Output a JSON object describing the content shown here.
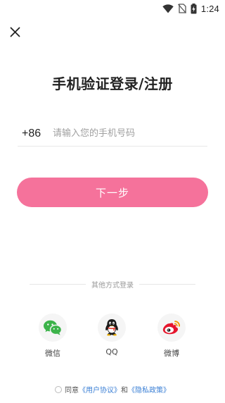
{
  "status_bar": {
    "time": "1:24",
    "icons": [
      "wifi-icon",
      "no-sim-icon",
      "battery-charging-icon"
    ]
  },
  "header": {
    "close_icon": "close-icon"
  },
  "title": "手机验证登录/注册",
  "phone": {
    "country_code": "+86",
    "placeholder": "请输入您的手机号码",
    "value": ""
  },
  "next_button": "下一步",
  "other_login": {
    "divider_label": "其他方式登录",
    "options": [
      {
        "label": "微信",
        "icon": "wechat-icon",
        "color": "#3cb34a"
      },
      {
        "label": "QQ",
        "icon": "qq-icon",
        "color": "#1a1a1a"
      },
      {
        "label": "微博",
        "icon": "weibo-icon",
        "color": "#e6162d"
      }
    ]
  },
  "agreement": {
    "prefix": "同意",
    "user_agreement": "《用户协议》",
    "and": "和",
    "privacy_policy": "《隐私政策》"
  },
  "colors": {
    "accent": "#f5729b",
    "link": "#3a7fd5"
  }
}
